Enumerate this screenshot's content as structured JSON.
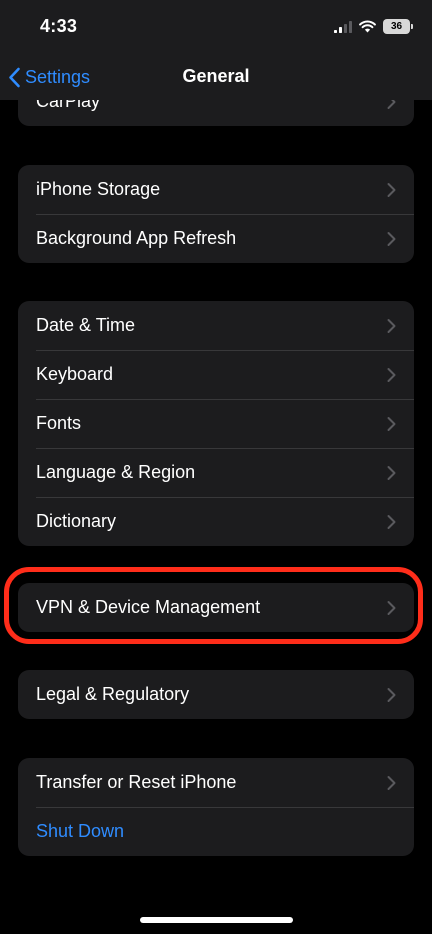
{
  "status_bar": {
    "time": "4:33",
    "battery": "36",
    "icons": [
      "cellular-signal-icon",
      "wifi-icon",
      "battery-icon"
    ]
  },
  "nav": {
    "back_label": "Settings",
    "title": "General"
  },
  "groups": [
    {
      "items": [
        {
          "label": "CarPlay"
        }
      ]
    },
    {
      "items": [
        {
          "label": "iPhone Storage"
        },
        {
          "label": "Background App Refresh"
        }
      ]
    },
    {
      "items": [
        {
          "label": "Date & Time"
        },
        {
          "label": "Keyboard"
        },
        {
          "label": "Fonts"
        },
        {
          "label": "Language & Region"
        },
        {
          "label": "Dictionary"
        }
      ]
    },
    {
      "items": [
        {
          "label": "VPN & Device Management"
        }
      ]
    },
    {
      "items": [
        {
          "label": "Legal & Regulatory"
        }
      ]
    },
    {
      "items": [
        {
          "label": "Transfer or Reset iPhone"
        },
        {
          "label": "Shut Down"
        }
      ]
    }
  ],
  "colors": {
    "background": "#000000",
    "cell": "#1c1c1e",
    "accent_blue": "#2f8cff",
    "highlight_red": "#ff2d1a"
  }
}
